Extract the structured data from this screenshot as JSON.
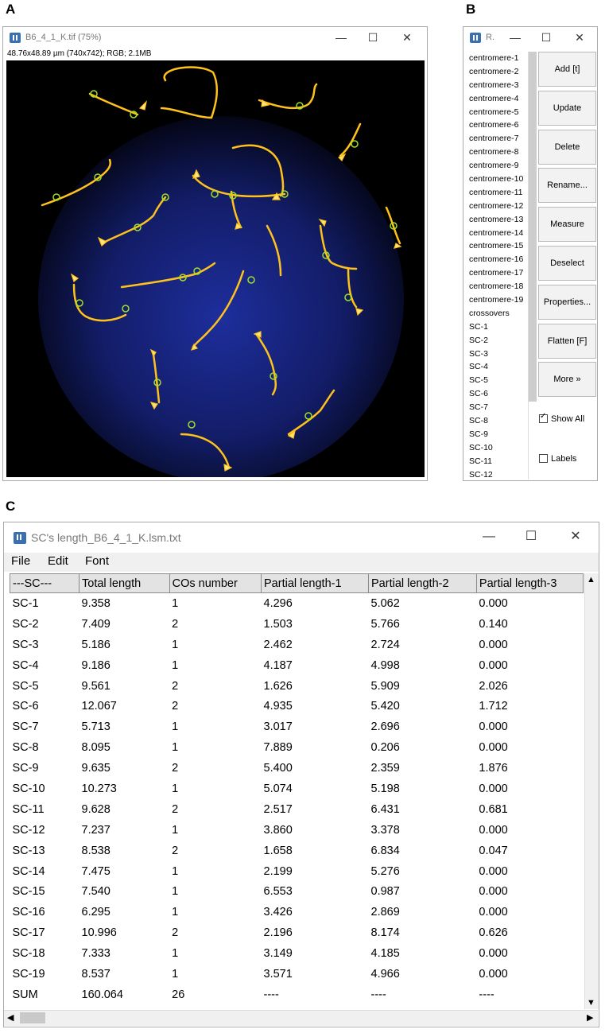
{
  "panels": {
    "a": "A",
    "b": "B",
    "c": "C"
  },
  "image_window": {
    "title": "B6_4_1_K.tif (75%)",
    "info": "48.76x48.89 µm (740x742); RGB; 2.1MB",
    "controls": {
      "minimize": "—",
      "maximize": "☐",
      "close": "✕"
    }
  },
  "roi_manager": {
    "title": "R.",
    "items": [
      "centromere-1",
      "centromere-2",
      "centromere-3",
      "centromere-4",
      "centromere-5",
      "centromere-6",
      "centromere-7",
      "centromere-8",
      "centromere-9",
      "centromere-10",
      "centromere-11",
      "centromere-12",
      "centromere-13",
      "centromere-14",
      "centromere-15",
      "centromere-16",
      "centromere-17",
      "centromere-18",
      "centromere-19",
      "crossovers",
      "SC-1",
      "SC-2",
      "SC-3",
      "SC-4",
      "SC-5",
      "SC-6",
      "SC-7",
      "SC-8",
      "SC-9",
      "SC-10",
      "SC-11",
      "SC-12"
    ],
    "buttons": [
      "Add [t]",
      "Update",
      "Delete",
      "Rename...",
      "Measure",
      "Deselect",
      "Properties...",
      "Flatten [F]",
      "More »"
    ],
    "show_all": {
      "label": "Show All",
      "checked": true
    },
    "labels": {
      "label": "Labels",
      "checked": false
    }
  },
  "results_window": {
    "title": "SC's length_B6_4_1_K.lsm.txt",
    "menu": [
      "File",
      "Edit",
      "Font"
    ],
    "columns": [
      "---SC---",
      "Total length",
      "COs number",
      "Partial length-1",
      "Partial length-2",
      "Partial length-3"
    ],
    "rows": [
      [
        "SC-1",
        "9.358",
        "1",
        "4.296",
        "5.062",
        "0.000"
      ],
      [
        "SC-2",
        "7.409",
        "2",
        "1.503",
        "5.766",
        "0.140"
      ],
      [
        "SC-3",
        "5.186",
        "1",
        "2.462",
        "2.724",
        "0.000"
      ],
      [
        "SC-4",
        "9.186",
        "1",
        "4.187",
        "4.998",
        "0.000"
      ],
      [
        "SC-5",
        "9.561",
        "2",
        "1.626",
        "5.909",
        "2.026"
      ],
      [
        "SC-6",
        "12.067",
        "2",
        "4.935",
        "5.420",
        "1.712"
      ],
      [
        "SC-7",
        "5.713",
        "1",
        "3.017",
        "2.696",
        "0.000"
      ],
      [
        "SC-8",
        "8.095",
        "1",
        "7.889",
        "0.206",
        "0.000"
      ],
      [
        "SC-9",
        "9.635",
        "2",
        "5.400",
        "2.359",
        "1.876"
      ],
      [
        "SC-10",
        "10.273",
        "1",
        "5.074",
        "5.198",
        "0.000"
      ],
      [
        "SC-11",
        "9.628",
        "2",
        "2.517",
        "6.431",
        "0.681"
      ],
      [
        "SC-12",
        "7.237",
        "1",
        "3.860",
        "3.378",
        "0.000"
      ],
      [
        "SC-13",
        "8.538",
        "2",
        "1.658",
        "6.834",
        "0.047"
      ],
      [
        "SC-14",
        "7.475",
        "1",
        "2.199",
        "5.276",
        "0.000"
      ],
      [
        "SC-15",
        "7.540",
        "1",
        "6.553",
        "0.987",
        "0.000"
      ],
      [
        "SC-16",
        "6.295",
        "1",
        "3.426",
        "2.869",
        "0.000"
      ],
      [
        "SC-17",
        "10.996",
        "2",
        "2.196",
        "8.174",
        "0.626"
      ],
      [
        "SC-18",
        "7.333",
        "1",
        "3.149",
        "4.185",
        "0.000"
      ],
      [
        "SC-19",
        "8.537",
        "1",
        "3.571",
        "4.966",
        "0.000"
      ],
      [
        "SUM",
        "160.064",
        "26",
        "----",
        "----",
        "----"
      ]
    ],
    "scroll": {
      "up": "▲",
      "down": "▼",
      "left": "◀",
      "right": "▶"
    }
  },
  "colors": {
    "accent_icon": "#3a6fb0",
    "sc_trace": "#ffc21a",
    "marker": "#9ee02a",
    "dapi": "#1b2fa0"
  }
}
